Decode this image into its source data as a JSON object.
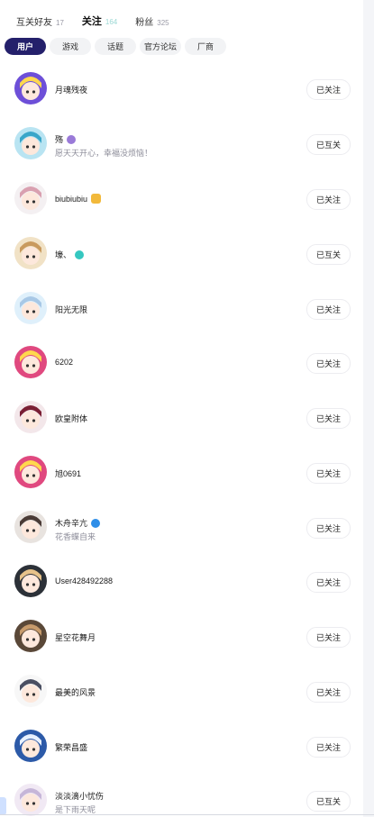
{
  "tabs": [
    {
      "label": "互关好友",
      "count": "17"
    },
    {
      "label": "关注",
      "count": "164"
    },
    {
      "label": "粉丝",
      "count": "325"
    }
  ],
  "filters": [
    "用户",
    "游戏",
    "话题",
    "官方论坛",
    "厂商"
  ],
  "users": [
    {
      "name": "月魂残夜",
      "signature": "",
      "button": "已关注",
      "avatar_bg": "#6d4fd8",
      "avatar_fg": "#ffd84d"
    },
    {
      "name": "殇",
      "signature": "愿天天开心，幸福没烦恼！",
      "button": "已互关",
      "avatar_bg": "#b9e4f2",
      "avatar_fg": "#3aa6c9",
      "badge_color": "#9a7ad8"
    },
    {
      "name": "biubiubiu",
      "signature": "",
      "button": "已关注",
      "avatar_bg": "#f4f0f2",
      "avatar_fg": "#d9a0b0",
      "emoji": true
    },
    {
      "name": "壕、",
      "signature": "",
      "button": "已互关",
      "avatar_bg": "#f1e2c6",
      "avatar_fg": "#c99a5e",
      "badge_color": "#35c7c0"
    },
    {
      "name": "阳光无限",
      "signature": "",
      "button": "已关注",
      "avatar_bg": "#dff0fb",
      "avatar_fg": "#a8c8e6"
    },
    {
      "name": "6202",
      "signature": "",
      "button": "已关注",
      "avatar_bg": "#e0497f",
      "avatar_fg": "#ffd84d"
    },
    {
      "name": "欧皇附体",
      "signature": "",
      "button": "已关注",
      "avatar_bg": "#f3e7ea",
      "avatar_fg": "#7a1f34"
    },
    {
      "name": "旭0691",
      "signature": "",
      "button": "已关注",
      "avatar_bg": "#e0497f",
      "avatar_fg": "#ffd84d"
    },
    {
      "name": "木舟辛亢",
      "signature": "花香蝶自来",
      "button": "已关注",
      "avatar_bg": "#e8e3df",
      "avatar_fg": "#4a3b36",
      "badge_color": "#2e8ee8"
    },
    {
      "name": "User428492288",
      "signature": "",
      "button": "已关注",
      "avatar_bg": "#2c3138",
      "avatar_fg": "#e6c28a"
    },
    {
      "name": "星空花舞月",
      "signature": "",
      "button": "已关注",
      "avatar_bg": "#5a4838",
      "avatar_fg": "#c79b6c"
    },
    {
      "name": "最美的风景",
      "signature": "",
      "button": "已关注",
      "avatar_bg": "#f7f7f7",
      "avatar_fg": "#4b4f62"
    },
    {
      "name": "繁荣昌盛",
      "signature": "",
      "button": "已关注",
      "avatar_bg": "#2c5aa8",
      "avatar_fg": "#e8f1ff"
    },
    {
      "name": "淡淡滴小忧伤",
      "signature": "是下雨天呢",
      "button": "已互关",
      "avatar_bg": "#f1e9f4",
      "avatar_fg": "#c6b6d8"
    }
  ]
}
